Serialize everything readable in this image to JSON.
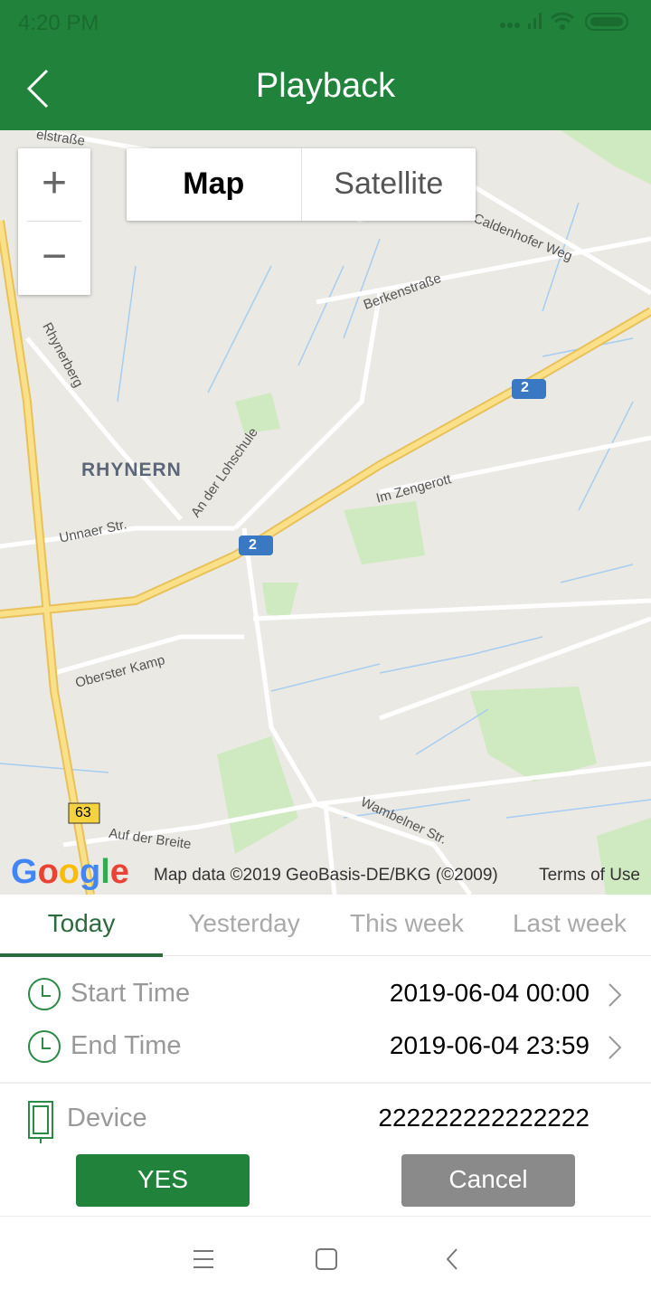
{
  "status_bar": {
    "time": "4:20 PM",
    "icons": [
      "signal-dots",
      "signal-bars",
      "wifi",
      "battery"
    ]
  },
  "header": {
    "title": "Playback",
    "back_icon": "chevron-left-icon"
  },
  "map": {
    "map_type_options": [
      "Map",
      "Satellite"
    ],
    "selected_map_type": "Map",
    "zoom_in": "+",
    "zoom_out": "−",
    "labels": {
      "rhynern": "RHYNERN",
      "rhynerberg": "Rhynerberg",
      "berkenstrasse": "Berkenstraße",
      "caldenhofer": "Caldenhofer Weg",
      "lohschule": "An der Lohschule",
      "zengerott": "Im Zengerott",
      "unnaer": "Unnaer Str.",
      "oberster": "Oberster Kamp",
      "auf_der_breite": "Auf der Breite",
      "wambelner": "Wambelner Str.",
      "alstrasse": "elstraße",
      "route2a": "2",
      "route2b": "2",
      "route63": "63"
    },
    "logo": "Google",
    "attribution": "Map data ©2019 GeoBasis-DE/BKG (©2009)",
    "terms": "Terms of Use"
  },
  "tabs": [
    {
      "label": "Today",
      "active": true
    },
    {
      "label": "Yesterday"
    },
    {
      "label": "This week"
    },
    {
      "label": "Last week"
    }
  ],
  "form": {
    "start_time": {
      "label": "Start Time",
      "value": "2019-06-04 00:00"
    },
    "end_time": {
      "label": "End Time",
      "value": "2019-06-04 23:59"
    },
    "device": {
      "label": "Device",
      "value": "222222222222222"
    }
  },
  "buttons": {
    "yes": "YES",
    "cancel": "Cancel"
  },
  "colors": {
    "primary": "#21833b",
    "cancel": "#8a8a8a",
    "highway": "#f8d26a",
    "water": "#9ec9f0",
    "park": "#c6e8b3"
  }
}
